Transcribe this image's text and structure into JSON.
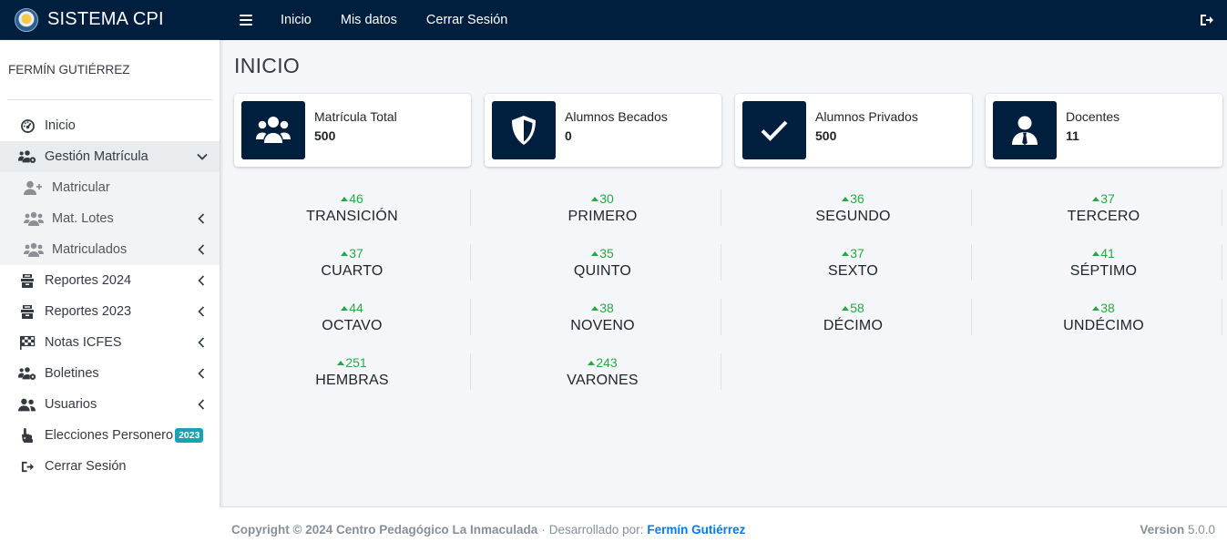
{
  "app": {
    "brand": "SISTEMA CPI"
  },
  "topnav": {
    "links": [
      "Inicio",
      "Mis datos",
      "Cerrar Sesión"
    ]
  },
  "user": {
    "name": "FERMÍN GUTIÉRREZ"
  },
  "sidebar": {
    "items": [
      {
        "label": "Inicio",
        "icon": "dashboard-icon"
      },
      {
        "label": "Gestión Matrícula",
        "icon": "users-cog-icon",
        "expanded": true
      },
      {
        "label": "Matricular",
        "icon": "user-plus-icon"
      },
      {
        "label": "Mat. Lotes",
        "icon": "users-icon"
      },
      {
        "label": "Matriculados",
        "icon": "users-icon"
      },
      {
        "label": "Reportes 2024",
        "icon": "archive-icon"
      },
      {
        "label": "Reportes 2023",
        "icon": "archive-icon"
      },
      {
        "label": "Notas ICFES",
        "icon": "flag-checkered-icon"
      },
      {
        "label": "Boletines",
        "icon": "users-cog-icon"
      },
      {
        "label": "Usuarios",
        "icon": "users-icon"
      },
      {
        "label": "Elecciones Personero",
        "icon": "hand-pointer-icon",
        "badge": "2023"
      },
      {
        "label": "Cerrar Sesión",
        "icon": "sign-out-icon"
      }
    ]
  },
  "page": {
    "title": "INICIO"
  },
  "info_boxes": [
    {
      "label": "Matrícula Total",
      "value": "500",
      "icon": "users-icon"
    },
    {
      "label": "Alumnos Becados",
      "value": "0",
      "icon": "shield-icon"
    },
    {
      "label": "Alumnos Privados",
      "value": "500",
      "icon": "check-icon"
    },
    {
      "label": "Docentes",
      "value": "11",
      "icon": "user-tie-icon"
    }
  ],
  "stats": [
    {
      "count": "46",
      "label": "TRANSICIÓN"
    },
    {
      "count": "30",
      "label": "PRIMERO"
    },
    {
      "count": "36",
      "label": "SEGUNDO"
    },
    {
      "count": "37",
      "label": "TERCERO"
    },
    {
      "count": "37",
      "label": "CUARTO"
    },
    {
      "count": "35",
      "label": "QUINTO"
    },
    {
      "count": "37",
      "label": "SEXTO"
    },
    {
      "count": "41",
      "label": "SÉPTIMO"
    },
    {
      "count": "44",
      "label": "OCTAVO"
    },
    {
      "count": "38",
      "label": "NOVENO"
    },
    {
      "count": "58",
      "label": "DÉCIMO"
    },
    {
      "count": "38",
      "label": "UNDÉCIMO"
    },
    {
      "count": "251",
      "label": "HEMBRAS"
    },
    {
      "count": "243",
      "label": "VARONES"
    }
  ],
  "footer": {
    "copyright": "Copyright © 2024 Centro Pedagógico La Inmaculada",
    "separator": "·",
    "dev_text": "Desarrollado por:",
    "dev_name": "Fermín Gutiérrez",
    "version_label": "Version",
    "version": "5.0.0"
  },
  "colors": {
    "navbar": "#001f3f",
    "accent_green": "#28a745",
    "badge": "#17a2b8",
    "link": "#007bff"
  }
}
